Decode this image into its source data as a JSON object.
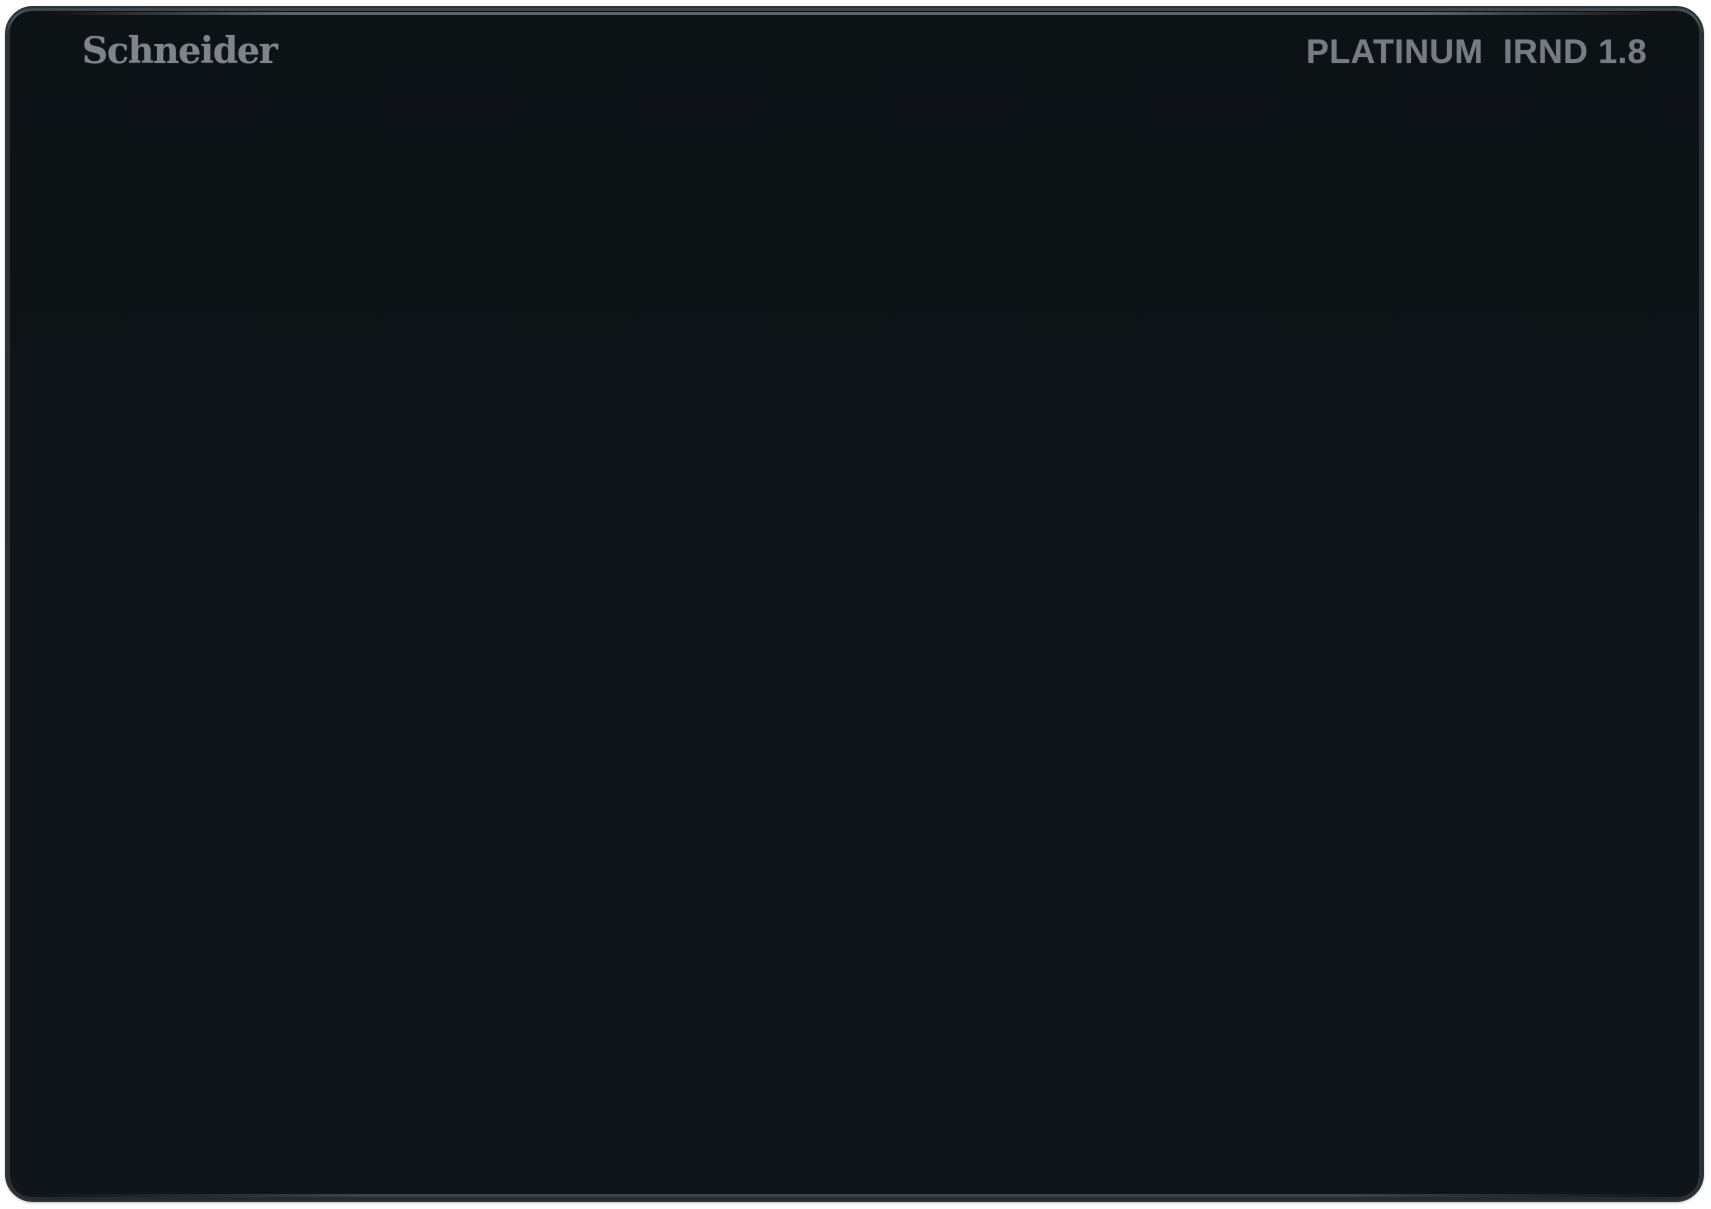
{
  "filter": {
    "brand": "Schneider",
    "label": "PLATINUM  IRND 1.8"
  },
  "colors": {
    "glass": "#0f1518",
    "engraving": "#7a8185",
    "background": "#ffffff"
  }
}
